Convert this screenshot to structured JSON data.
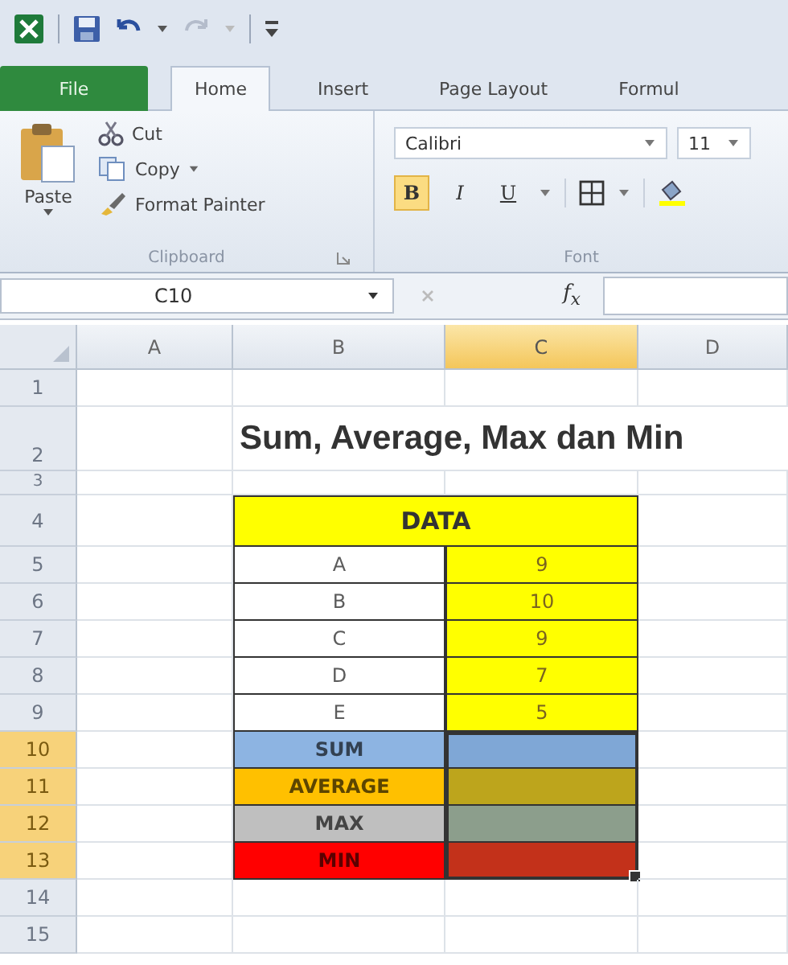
{
  "tabs": [
    {
      "label": "File",
      "kind": "file",
      "selected": false
    },
    {
      "label": "Home",
      "kind": "tab",
      "selected": true
    },
    {
      "label": "Insert",
      "kind": "tab",
      "selected": false
    },
    {
      "label": "Page Layout",
      "kind": "tab",
      "selected": false
    },
    {
      "label": "Formul",
      "kind": "tab",
      "selected": false
    }
  ],
  "clipboard": {
    "paste": "Paste",
    "cut": "Cut",
    "copy": "Copy",
    "format_painter": "Format Painter",
    "label": "Clipboard"
  },
  "font": {
    "name": "Calibri",
    "size": "11",
    "label": "Font",
    "buttons": [
      {
        "label": "B",
        "kind": "bold",
        "on": true
      },
      {
        "label": "I",
        "kind": "italic",
        "on": false
      },
      {
        "label": "U",
        "kind": "underline",
        "on": false
      }
    ]
  },
  "formula_bar": {
    "name_box": "C10",
    "fx": "f$_{x}$"
  },
  "sheet": {
    "columns": [
      {
        "label": "A",
        "selected": false
      },
      {
        "label": "B",
        "selected": false
      },
      {
        "label": "C",
        "selected": true
      },
      {
        "label": "D",
        "selected": false
      }
    ],
    "rows": [
      {
        "number": "1",
        "kind": "normal",
        "selected": false
      },
      {
        "number": "2",
        "kind": "tall",
        "selected": false,
        "title": "Sum, Average, Max dan Min"
      },
      {
        "number": "3",
        "kind": "short",
        "selected": false
      },
      {
        "number": "4",
        "kind": "header",
        "selected": false,
        "merged": {
          "text": "DATA",
          "color": "#ffff00",
          "bold": true
        }
      },
      {
        "number": "5",
        "kind": "normal",
        "selected": false,
        "b": {
          "text": "A",
          "color": "#ffffff",
          "bold": false
        },
        "c": {
          "text": "9",
          "color": "#ffff00"
        }
      },
      {
        "number": "6",
        "kind": "normal",
        "selected": false,
        "b": {
          "text": "B",
          "color": "#ffffff",
          "bold": false
        },
        "c": {
          "text": "10",
          "color": "#ffff00"
        }
      },
      {
        "number": "7",
        "kind": "normal",
        "selected": false,
        "b": {
          "text": "C",
          "color": "#ffffff",
          "bold": false
        },
        "c": {
          "text": "9",
          "color": "#ffff00"
        }
      },
      {
        "number": "8",
        "kind": "normal",
        "selected": false,
        "b": {
          "text": "D",
          "color": "#ffffff",
          "bold": false
        },
        "c": {
          "text": "7",
          "color": "#ffff00"
        }
      },
      {
        "number": "9",
        "kind": "normal",
        "selected": false,
        "b": {
          "text": "E",
          "color": "#ffffff",
          "bold": false
        },
        "c": {
          "text": "5",
          "color": "#ffff00"
        }
      },
      {
        "number": "10",
        "kind": "normal",
        "selected": true,
        "b": {
          "text": "SUM",
          "color": "#8db4e2",
          "bold": true
        },
        "c": {
          "color": "#7fa7d6"
        }
      },
      {
        "number": "11",
        "kind": "normal",
        "selected": true,
        "b": {
          "text": "AVERAGE",
          "color": "#ffc000",
          "bold": true
        },
        "c": {
          "color": "#bda51c"
        }
      },
      {
        "number": "12",
        "kind": "normal",
        "selected": true,
        "b": {
          "text": "MAX",
          "color": "#bfbfbf",
          "bold": true
        },
        "c": {
          "color": "#8c9e8c"
        }
      },
      {
        "number": "13",
        "kind": "normal",
        "selected": true,
        "b": {
          "text": "MIN",
          "color": "#ff0000",
          "bold": true
        },
        "c": {
          "color": "#c3311a"
        }
      },
      {
        "number": "14",
        "kind": "normal",
        "selected": false
      },
      {
        "number": "15",
        "kind": "normal",
        "selected": false
      }
    ]
  }
}
